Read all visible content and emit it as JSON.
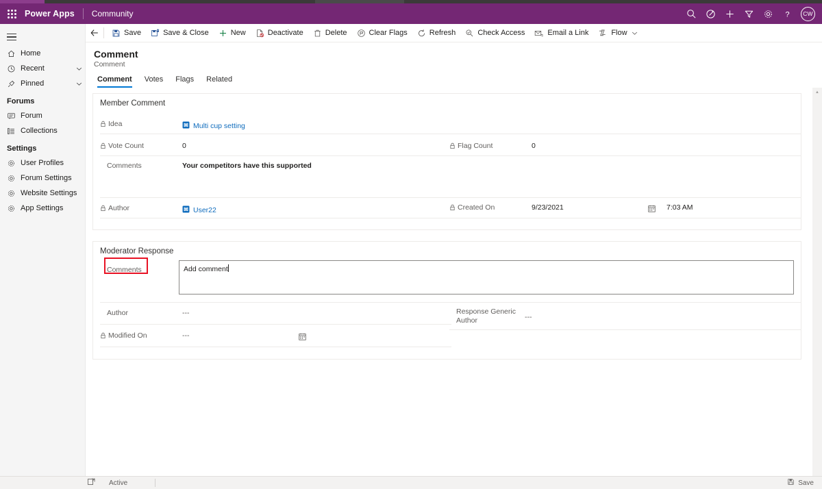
{
  "appbar": {
    "waffle_label": "app-launcher",
    "brand": "Power Apps",
    "app_name": "Community",
    "icons": [
      "search-icon",
      "assistant-icon",
      "plus-icon",
      "filter-icon",
      "gear-icon",
      "help-icon"
    ],
    "avatar_initials": "CW",
    "background": "#742774"
  },
  "sidebar": {
    "items": [
      {
        "label": "Home",
        "icon": "home-icon",
        "chevron": false
      },
      {
        "label": "Recent",
        "icon": "clock-icon",
        "chevron": true
      },
      {
        "label": "Pinned",
        "icon": "pin-icon",
        "chevron": true
      }
    ],
    "group_forums": "Forums",
    "forums_items": [
      {
        "label": "Forum",
        "icon": "forum-icon"
      },
      {
        "label": "Collections",
        "icon": "collections-icon"
      }
    ],
    "group_settings": "Settings",
    "settings_items": [
      {
        "label": "User Profiles",
        "icon": "gear-icon"
      },
      {
        "label": "Forum Settings",
        "icon": "gear-icon"
      },
      {
        "label": "Website Settings",
        "icon": "gear-icon"
      },
      {
        "label": "App Settings",
        "icon": "gear-icon"
      }
    ]
  },
  "commandbar": {
    "back": "back-arrow",
    "items": [
      {
        "label": "Save",
        "icon": "save-icon"
      },
      {
        "label": "Save & Close",
        "icon": "save-close-icon"
      },
      {
        "label": "New",
        "icon": "plus-icon"
      },
      {
        "label": "Deactivate",
        "icon": "deactivate-icon"
      },
      {
        "label": "Delete",
        "icon": "trash-icon"
      },
      {
        "label": "Clear Flags",
        "icon": "clear-flags-icon"
      },
      {
        "label": "Refresh",
        "icon": "refresh-icon"
      },
      {
        "label": "Check Access",
        "icon": "check-access-icon"
      },
      {
        "label": "Email a Link",
        "icon": "email-link-icon"
      },
      {
        "label": "Flow",
        "icon": "flow-icon",
        "caret": true
      }
    ]
  },
  "page": {
    "title": "Comment",
    "subtitle": "Comment",
    "tabs": [
      {
        "label": "Comment",
        "active": true
      },
      {
        "label": "Votes",
        "active": false
      },
      {
        "label": "Flags",
        "active": false
      },
      {
        "label": "Related",
        "active": false
      }
    ]
  },
  "member_comment": {
    "section_title": "Member Comment",
    "idea": {
      "label": "Idea",
      "locked": true,
      "value": "Multi cup setting",
      "is_link": true
    },
    "vote_count": {
      "label": "Vote Count",
      "locked": true,
      "value": "0"
    },
    "flag_count": {
      "label": "Flag Count",
      "locked": true,
      "value": "0"
    },
    "comments": {
      "label": "Comments",
      "locked": false,
      "value": "Your competitors have this supported"
    },
    "author": {
      "label": "Author",
      "locked": true,
      "value": "User22",
      "is_link": true
    },
    "created_on": {
      "label": "Created On",
      "locked": true,
      "date": "9/23/2021",
      "time": "7:03 AM"
    }
  },
  "moderator_response": {
    "section_title": "Moderator Response",
    "comments": {
      "label": "Comments",
      "value": "Add comment",
      "highlighted": true
    },
    "author": {
      "label": "Author",
      "locked": false,
      "value": "---"
    },
    "response_generic_author": {
      "label": "Response Generic Author",
      "value": "---"
    },
    "modified_on": {
      "label": "Modified On",
      "locked": true,
      "value": "---"
    }
  },
  "highlight": {
    "color": "#e81123"
  },
  "statusbar": {
    "state_icon": "popout-icon",
    "state": "Active",
    "save_label": "Save",
    "save_icon": "save-icon"
  }
}
